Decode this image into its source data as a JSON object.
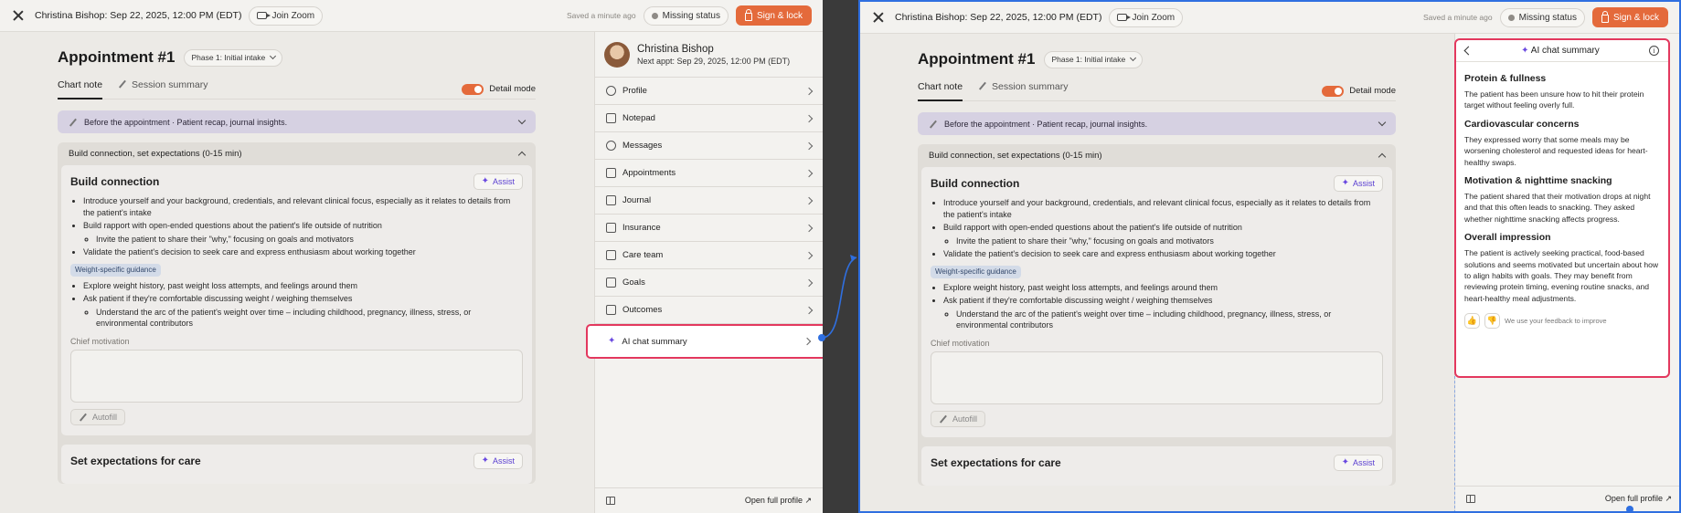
{
  "topbar": {
    "appointment": "Christina Bishop: Sep 22, 2025, 12:00 PM (EDT)",
    "join_zoom": "Join Zoom",
    "saved": "Saved a minute ago",
    "missing_status": "Missing status",
    "sign_lock": "Sign & lock"
  },
  "main": {
    "title": "Appointment #1",
    "phase": "Phase 1: Initial intake",
    "tabs": [
      {
        "label": "Chart note"
      },
      {
        "label": "Session summary"
      }
    ],
    "detail_mode": "Detail mode",
    "banner": "Before the appointment · Patient recap, journal insights.",
    "section_title": "Build connection, set expectations (0-15 min)",
    "card1": {
      "title": "Build connection",
      "assist": "Assist",
      "bullets": [
        "Introduce yourself and your background, credentials, and relevant clinical focus, especially as it relates to details from the patient's intake",
        "Build rapport with open-ended questions about the patient's life outside of nutrition",
        "Invite the patient to share their \"why,\" focusing on goals and motivators",
        "Validate the patient's decision to seek care and express enthusiasm about working together"
      ],
      "tag": "Weight-specific guidance",
      "bullets2": [
        "Explore weight history, past weight loss attempts, and feelings around them",
        "Ask patient if they're comfortable discussing weight / weighing themselves",
        "Understand the arc of the patient's weight over time – including childhood, pregnancy, illness, stress, or environmental contributors"
      ],
      "field_label": "Chief motivation",
      "autofill": "Autofill"
    },
    "card2": {
      "title": "Set expectations for care",
      "assist": "Assist"
    }
  },
  "sidebar": {
    "patient_name": "Christina Bishop",
    "next_appt": "Next appt: Sep 29, 2025, 12:00 PM (EDT)",
    "items": [
      {
        "label": "Profile"
      },
      {
        "label": "Notepad"
      },
      {
        "label": "Messages"
      },
      {
        "label": "Appointments"
      },
      {
        "label": "Journal"
      },
      {
        "label": "Insurance"
      },
      {
        "label": "Care team"
      },
      {
        "label": "Goals"
      },
      {
        "label": "Outcomes"
      },
      {
        "label": "AI chat summary"
      }
    ],
    "open_profile": "Open full profile ↗"
  },
  "ai_panel": {
    "title": "AI chat summary",
    "sections": [
      {
        "heading": "Protein & fullness",
        "text": "The patient has been unsure how to hit their protein target without feeling overly full."
      },
      {
        "heading": "Cardiovascular concerns",
        "text": "They expressed worry that some meals may be worsening cholesterol and requested ideas for heart-healthy swaps."
      },
      {
        "heading": "Motivation & nighttime snacking",
        "text": "The patient shared that their motivation drops at night and that this often leads to snacking. They asked whether nighttime snacking affects progress."
      },
      {
        "heading": "Overall impression",
        "text": "The patient is actively seeking practical, food-based solutions and seems motivated but uncertain about how to align habits with goals. They may benefit from reviewing protein timing, evening routine snacks, and heart-healthy meal adjustments."
      }
    ],
    "feedback": "We use your feedback to improve"
  },
  "colors": {
    "accent": "#e46a3b",
    "highlight": "#e3385e",
    "connector": "#2f6fe0",
    "assist": "#5a3fd1"
  },
  "icons": [
    "close-icon",
    "video-icon",
    "lock-icon",
    "wand-icon",
    "sparkle-icon",
    "chevron-right-icon",
    "info-icon",
    "thumbs-up-icon",
    "thumbs-down-icon",
    "panel-icon"
  ]
}
